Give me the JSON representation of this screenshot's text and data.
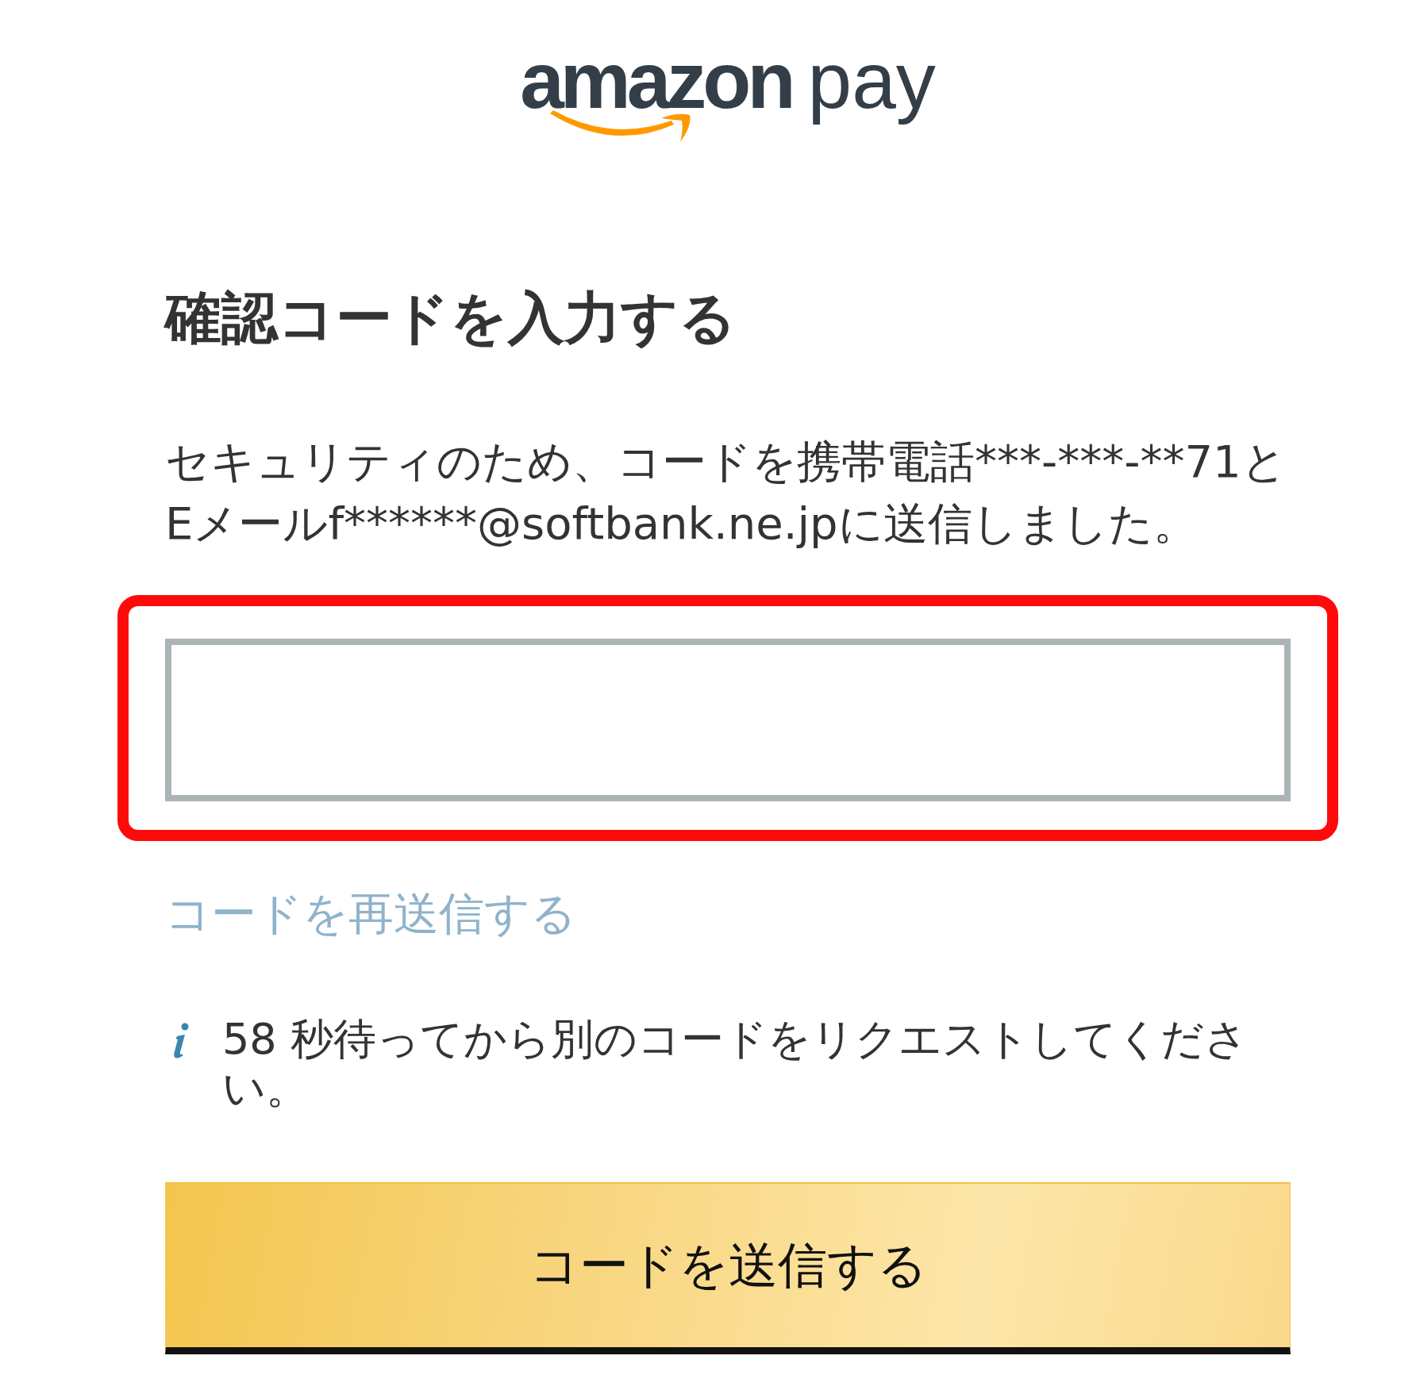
{
  "logo": {
    "brand": "amazon",
    "product": "pay"
  },
  "heading": "確認コードを入力する",
  "message": "セキュリティのため、コードを携帯電話***-***-**71とEメールf******@softbank.ne.jpに送信しました。",
  "code_input": {
    "highlighted": true
  },
  "resend_link": {
    "label": "コードを再送信する",
    "disabled": true
  },
  "notice": {
    "text": "58 秒待ってから別のコードをリクエストしてください。"
  },
  "submit_button": {
    "label": "コードを送信する"
  }
}
